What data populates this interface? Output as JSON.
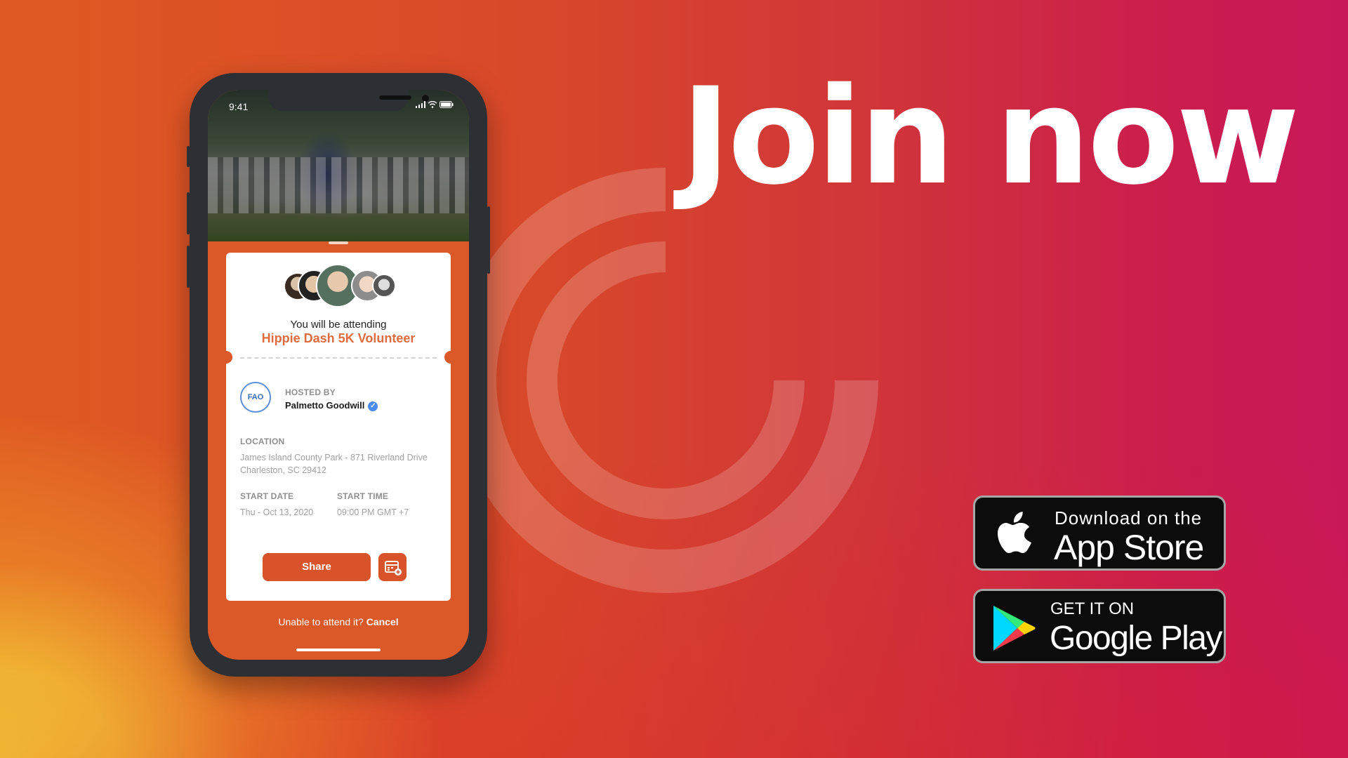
{
  "headline": "Join now",
  "colors": {
    "brand_orange": "#db5829",
    "accent_orange_text": "#e06b3f",
    "verified_blue": "#4a8cf0",
    "badge_black": "#0c0c0c",
    "bg_pink": "#c8185a",
    "bg_yellow": "#f7e637"
  },
  "phone": {
    "status_time": "9:41",
    "status_icons": "signal-icon wifi-icon battery-icon",
    "card": {
      "attend_prefix": "You will be attending",
      "event_title": "Hippie Dash 5K Volunteer",
      "hosted_by_label": "HOSTED BY",
      "host_name": "Palmetto Goodwill",
      "host_logo_text": "FAO",
      "location_label": "LOCATION",
      "location_line1": "James Island County Park - 871 Riverland Drive",
      "location_line2": "Charleston,  SC 29412",
      "start_date_label": "START DATE",
      "start_date_value": "Thu - Oct 13, 2020",
      "start_time_label": "START TIME",
      "start_time_value": "09:00 PM GMT +7",
      "share_label": "Share"
    },
    "cancel_prefix": "Unable to attend it?",
    "cancel_link": "Cancel"
  },
  "badges": {
    "apple_small": "Download on the",
    "apple_big": "App Store",
    "google_small": "GET IT ON",
    "google_big": "Google Play"
  }
}
